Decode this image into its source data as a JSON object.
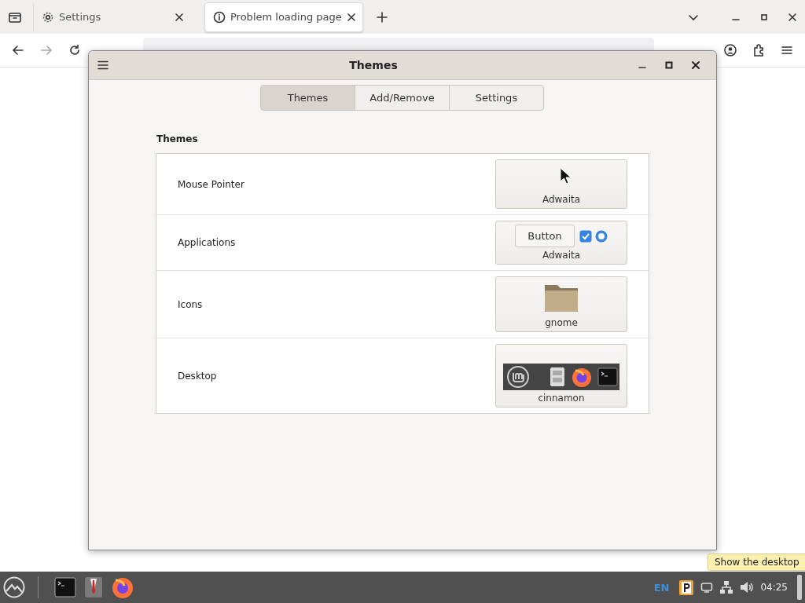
{
  "browser": {
    "tabs": [
      {
        "label": "Settings",
        "kind": "gear",
        "selected": false
      },
      {
        "label": "Problem loading page",
        "kind": "info",
        "selected": true
      }
    ]
  },
  "dialog": {
    "title": "Themes",
    "tabs": [
      {
        "label": "Themes",
        "selected": true
      },
      {
        "label": "Add/Remove",
        "selected": false
      },
      {
        "label": "Settings",
        "selected": false
      }
    ],
    "section_title": "Themes",
    "rows": [
      {
        "label": "Mouse Pointer",
        "kind": "pointer",
        "value": "Adwaita"
      },
      {
        "label": "Applications",
        "kind": "app",
        "value": "Adwaita",
        "button": "Button",
        "checked": true,
        "radio_selected": true
      },
      {
        "label": "Icons",
        "kind": "icons",
        "value": "gnome"
      },
      {
        "label": "Desktop",
        "kind": "desktop",
        "value": "cinnamon"
      }
    ]
  },
  "taskbar": {
    "language": "EN",
    "clock": "04:25",
    "tooltip": "Show the desktop"
  }
}
